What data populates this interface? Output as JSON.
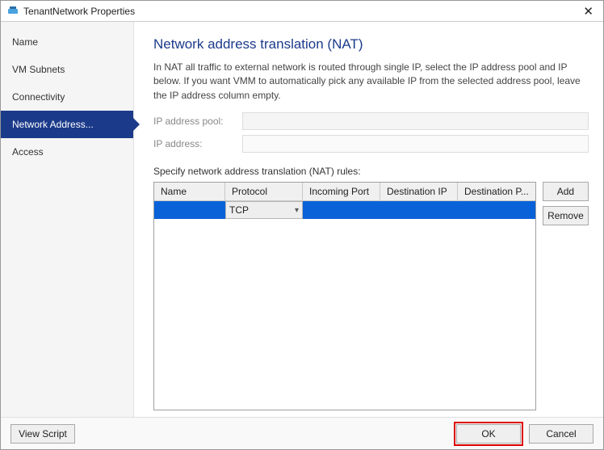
{
  "window": {
    "title": "TenantNetwork Properties",
    "close_glyph": "✕"
  },
  "sidebar": {
    "items": [
      {
        "label": "Name"
      },
      {
        "label": "VM Subnets"
      },
      {
        "label": "Connectivity"
      },
      {
        "label": "Network Address..."
      },
      {
        "label": "Access"
      }
    ],
    "active_index": 3
  },
  "main": {
    "heading": "Network address translation (NAT)",
    "description": "In NAT all traffic to external network is routed through single IP, select the IP address pool and IP below. If you want VMM to automatically pick any available IP from the selected address pool, leave the IP address column empty.",
    "ip_pool_label": "IP address pool:",
    "ip_pool_value": "",
    "ip_addr_label": "IP address:",
    "ip_addr_value": "",
    "rules_label": "Specify network address translation (NAT) rules:",
    "columns": {
      "name": "Name",
      "protocol": "Protocol",
      "incoming_port": "Incoming Port",
      "destination_ip": "Destination IP",
      "destination_port": "Destination P..."
    },
    "rows": [
      {
        "name": "",
        "protocol": "TCP",
        "incoming_port": "",
        "destination_ip": "",
        "destination_port": ""
      }
    ],
    "add_label": "Add",
    "remove_label": "Remove"
  },
  "footer": {
    "view_script": "View Script",
    "ok": "OK",
    "cancel": "Cancel"
  }
}
